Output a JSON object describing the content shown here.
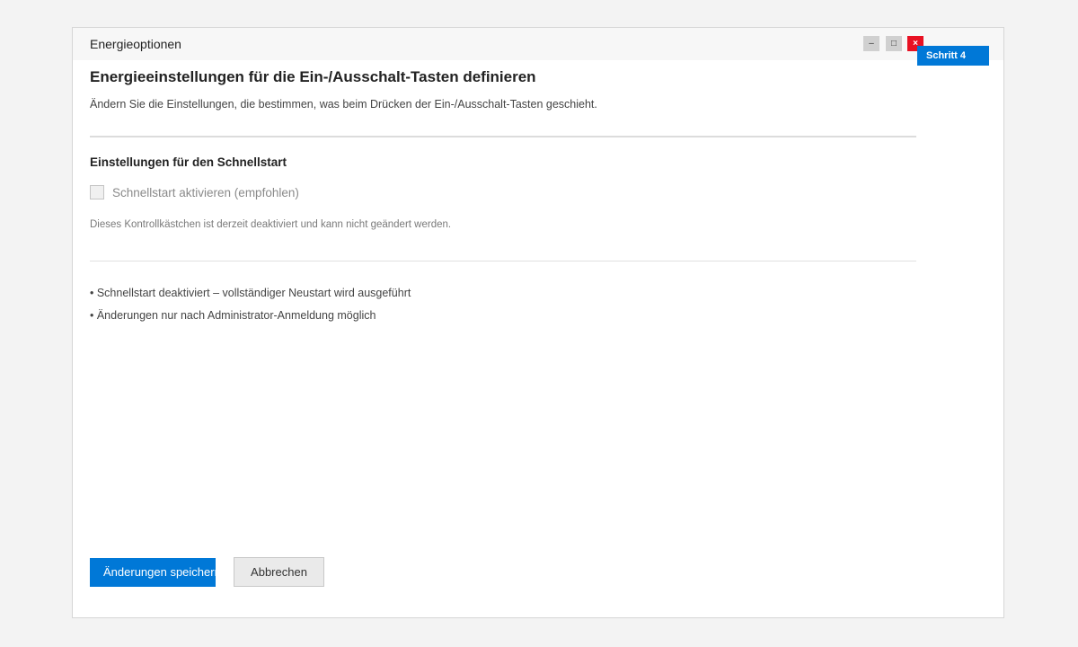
{
  "window": {
    "title": "Energieoptionen",
    "controls": {
      "minimize": "–",
      "maximize": "□",
      "close": "×"
    },
    "step_badge": "Schritt 4"
  },
  "content": {
    "heading": "Energieeinstellungen für die Ein-/Ausschalt-Tasten definieren",
    "subtitle": "Ändern Sie die Einstellungen, die bestimmen, was beim Drücken der Ein-/Ausschalt-Tasten geschieht.",
    "section_title": "Einstellungen für den Schnellstart",
    "checkbox": {
      "label": "Schnellstart aktivieren (empfohlen)",
      "checked": false,
      "disabled": true
    },
    "note": "Dieses Kontrollkästchen ist derzeit deaktiviert und kann nicht geändert werden.",
    "bullets": [
      "• Schnellstart deaktiviert – vollständiger Neustart wird ausgeführt",
      "• Änderungen nur nach Administrator-Anmeldung möglich"
    ]
  },
  "buttons": {
    "save_label": "Änderungen speichern",
    "cancel_label": "Abbrechen"
  },
  "colors": {
    "accent": "#0078d7",
    "close": "#e81123"
  }
}
